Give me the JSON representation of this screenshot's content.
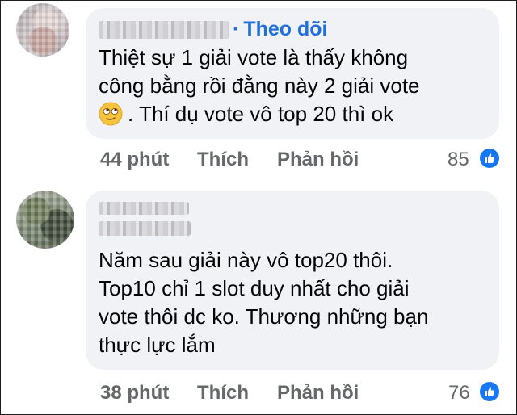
{
  "comments": [
    {
      "author_follow": "Theo dõi",
      "follow_dot": "·",
      "text_lines": [
        "Thiệt sự 1 giải vote là thấy không",
        "công bằng rồi đằng này 2 giải vote",
        ". Thí dụ vote vô top 20 thì ok"
      ],
      "emoji": "smiling-face-with-rolling-eyes-emoji",
      "time": "44 phút",
      "like_label": "Thích",
      "reply_label": "Phản hồi",
      "reaction_count": "85",
      "reaction_icon": "like-thumbs-up-icon"
    },
    {
      "text_lines": [
        "Năm sau giải này vô top20 thôi.",
        "Top10 chỉ 1 slot duy nhất cho giải",
        "vote thôi dc ko. Thương những bạn",
        "thực lực lắm"
      ],
      "time": "38 phút",
      "like_label": "Thích",
      "reply_label": "Phản hồi",
      "reaction_count": "76",
      "reaction_icon": "like-thumbs-up-icon"
    }
  ],
  "colors": {
    "bubble": "#f0f2f5",
    "follow_link": "#216fdb",
    "meta_text": "#65676b",
    "like_badge": "#1877f2"
  }
}
